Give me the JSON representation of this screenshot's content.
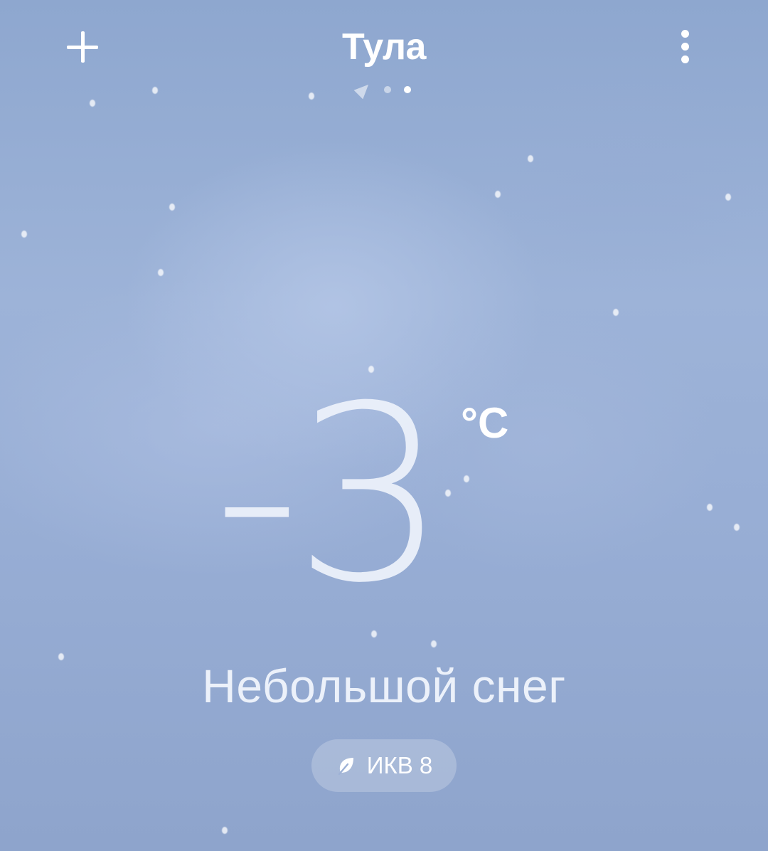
{
  "header": {
    "city": "Тула",
    "add_icon": "plus-icon",
    "menu_icon": "more-vert-icon",
    "pages": {
      "count": 3,
      "current": 3,
      "first_is_location": true
    }
  },
  "current": {
    "temperature": "-3",
    "unit": "°C",
    "condition": "Небольшой снег"
  },
  "aqi": {
    "label": "ИКВ 8",
    "icon": "leaf-icon"
  },
  "colors": {
    "sky_top": "#8ea7cf",
    "sky_mid": "#9db3d8",
    "text": "#ffffff"
  }
}
